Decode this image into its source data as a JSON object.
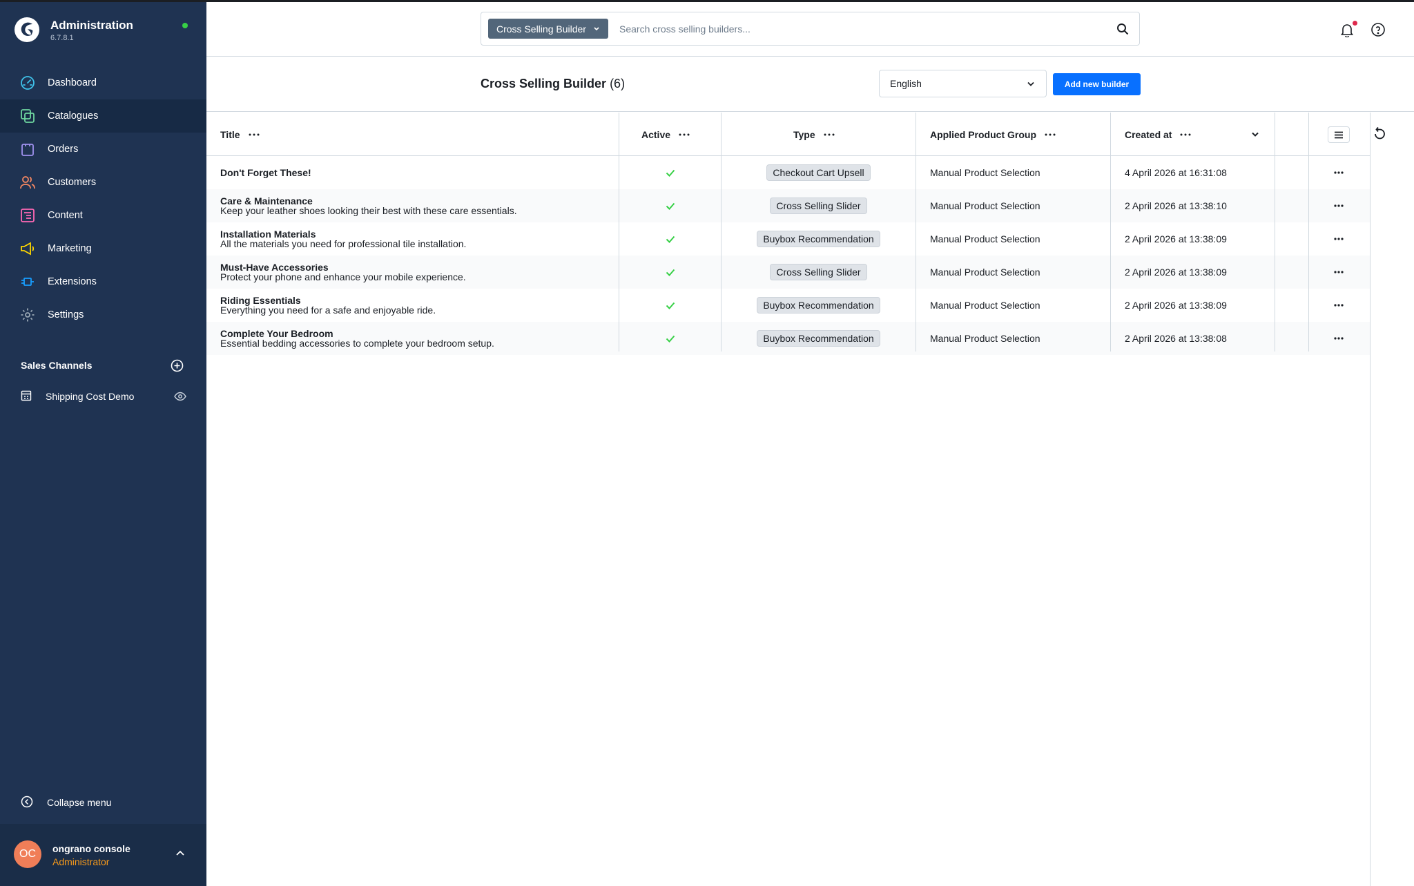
{
  "app": {
    "title": "Administration",
    "version": "6.7.8.1",
    "status_color": "#37d046"
  },
  "sidebar": {
    "items": [
      {
        "label": "Dashboard",
        "icon": "gauge-icon",
        "color": "#3fc2ea",
        "active": false
      },
      {
        "label": "Catalogues",
        "icon": "catalogue-icon",
        "color": "#6ed59f",
        "active": true
      },
      {
        "label": "Orders",
        "icon": "shopping-bag-icon",
        "color": "#a092f0",
        "active": false
      },
      {
        "label": "Customers",
        "icon": "users-icon",
        "color": "#f88962",
        "active": false
      },
      {
        "label": "Content",
        "icon": "content-icon",
        "color": "#ff68b4",
        "active": false
      },
      {
        "label": "Marketing",
        "icon": "megaphone-icon",
        "color": "#ffd700",
        "active": false
      },
      {
        "label": "Extensions",
        "icon": "plug-icon",
        "color": "#189eff",
        "active": false
      },
      {
        "label": "Settings",
        "icon": "gear-icon",
        "color": "#9aa8b5",
        "active": false
      }
    ],
    "sales_channels_title": "Sales Channels",
    "channels": [
      {
        "label": "Shipping Cost Demo",
        "icon": "storefront-icon"
      }
    ],
    "collapse_label": "Collapse menu"
  },
  "user": {
    "initials": "OC",
    "name": "ongrano console",
    "role": "Administrator"
  },
  "search": {
    "entity_label": "Cross Selling Builder",
    "placeholder": "Search cross selling builders..."
  },
  "page": {
    "title": "Cross Selling Builder",
    "count": "(6)",
    "language": "English",
    "add_button": "Add new builder"
  },
  "table": {
    "columns": {
      "title": "Title",
      "active": "Active",
      "type": "Type",
      "group": "Applied Product Group",
      "created": "Created at"
    },
    "rows": [
      {
        "title": "Don't Forget These!",
        "description": "",
        "active": true,
        "type": "Checkout Cart Upsell",
        "group": "Manual Product Selection",
        "created": "4 April 2026 at 16:31:08"
      },
      {
        "title": "Care & Maintenance",
        "description": "Keep your leather shoes looking their best with these care essentials.",
        "active": true,
        "type": "Cross Selling Slider",
        "group": "Manual Product Selection",
        "created": "2 April 2026 at 13:38:10"
      },
      {
        "title": "Installation Materials",
        "description": "All the materials you need for professional tile installation.",
        "active": true,
        "type": "Buybox Recommendation",
        "group": "Manual Product Selection",
        "created": "2 April 2026 at 13:38:09"
      },
      {
        "title": "Must-Have Accessories",
        "description": "Protect your phone and enhance your mobile experience.",
        "active": true,
        "type": "Cross Selling Slider",
        "group": "Manual Product Selection",
        "created": "2 April 2026 at 13:38:09"
      },
      {
        "title": "Riding Essentials",
        "description": "Everything you need for a safe and enjoyable ride.",
        "active": true,
        "type": "Buybox Recommendation",
        "group": "Manual Product Selection",
        "created": "2 April 2026 at 13:38:09"
      },
      {
        "title": "Complete Your Bedroom",
        "description": "Essential bedding accessories to complete your bedroom setup.",
        "active": true,
        "type": "Buybox Recommendation",
        "group": "Manual Product Selection",
        "created": "2 April 2026 at 13:38:08"
      }
    ]
  },
  "colors": {
    "sidebar_bg": "#1f3352",
    "accent": "#0870ff",
    "check": "#37d046"
  }
}
